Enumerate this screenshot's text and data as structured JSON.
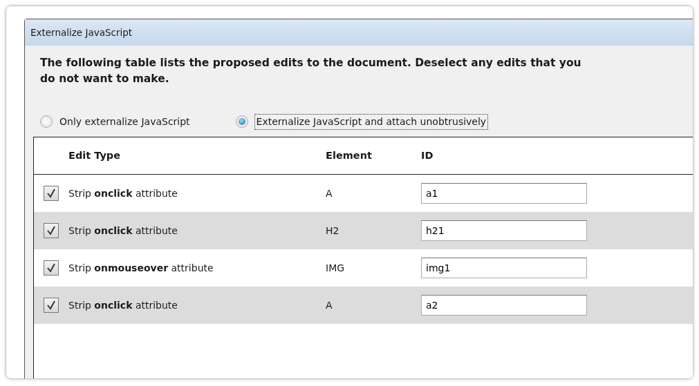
{
  "window": {
    "title": "Externalize JavaScript"
  },
  "description": "The following table lists the proposed edits to the document. Deselect any edits that you do not want to make.",
  "options": [
    {
      "label": "Only externalize JavaScript",
      "selected": false
    },
    {
      "label": "Externalize JavaScript and attach unobtrusively",
      "selected": true
    }
  ],
  "table": {
    "columns": [
      "Edit Type",
      "Element",
      "ID"
    ],
    "rows": [
      {
        "checked": true,
        "edit_type": "Strip **onclick** attribute",
        "element": "A",
        "id": "a1"
      },
      {
        "checked": true,
        "edit_type": "Strip **onclick** attribute",
        "element": "H2",
        "id": "h21"
      },
      {
        "checked": true,
        "edit_type": "Strip **onmouseover** attribute",
        "element": "IMG",
        "id": "img1"
      },
      {
        "checked": true,
        "edit_type": "Strip **onclick** attribute",
        "element": "A",
        "id": "a2"
      }
    ]
  }
}
